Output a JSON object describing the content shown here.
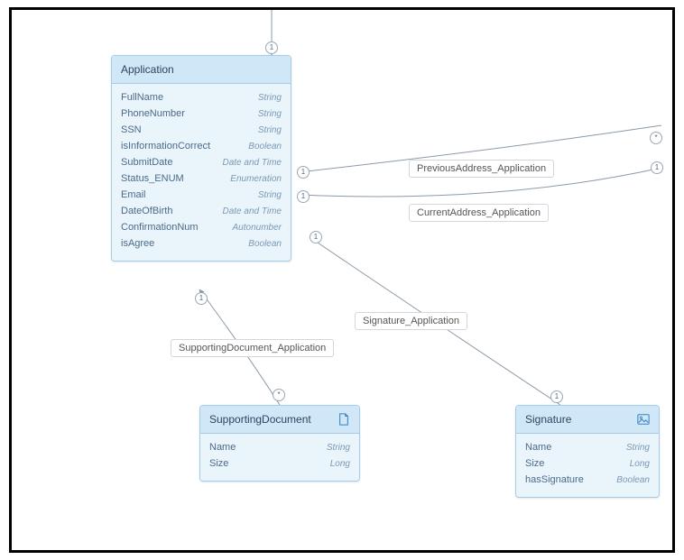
{
  "entities": {
    "application": {
      "title": "Application",
      "attrs": [
        {
          "name": "FullName",
          "type": "String"
        },
        {
          "name": "PhoneNumber",
          "type": "String"
        },
        {
          "name": "SSN",
          "type": "String"
        },
        {
          "name": "isInformationCorrect",
          "type": "Boolean"
        },
        {
          "name": "SubmitDate",
          "type": "Date and Time"
        },
        {
          "name": "Status_ENUM",
          "type": "Enumeration"
        },
        {
          "name": "Email",
          "type": "String"
        },
        {
          "name": "DateOfBirth",
          "type": "Date and Time"
        },
        {
          "name": "ConfirmationNum",
          "type": "Autonumber"
        },
        {
          "name": "isAgree",
          "type": "Boolean"
        }
      ]
    },
    "supportingDocument": {
      "title": "SupportingDocument",
      "attrs": [
        {
          "name": "Name",
          "type": "String"
        },
        {
          "name": "Size",
          "type": "Long"
        }
      ]
    },
    "signature": {
      "title": "Signature",
      "attrs": [
        {
          "name": "Name",
          "type": "String"
        },
        {
          "name": "Size",
          "type": "Long"
        },
        {
          "name": "hasSignature",
          "type": "Boolean"
        }
      ]
    }
  },
  "relations": {
    "prevAddr": "PreviousAddress_Application",
    "currAddr": "CurrentAddress_Application",
    "sigApp": "Signature_Application",
    "supDoc": "SupportingDocument_Application"
  },
  "multiplicities": {
    "one": "1",
    "star": "*"
  }
}
